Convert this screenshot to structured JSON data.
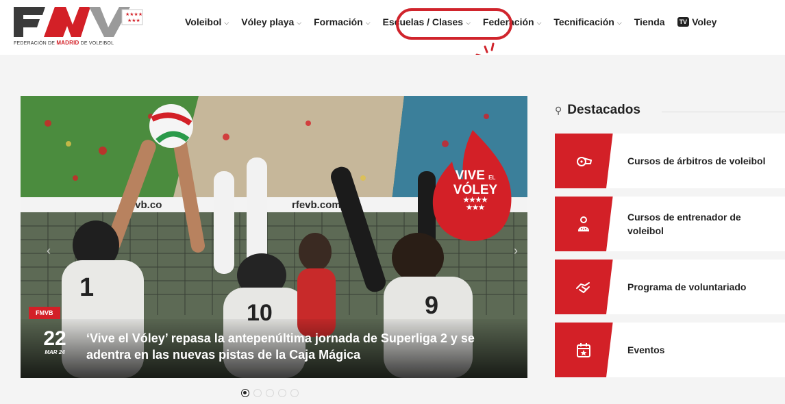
{
  "header": {
    "logo": {
      "mark_text": "FMV",
      "caption_pre": "FEDERACIÓN DE ",
      "caption_red": "MADRID",
      "caption_post": " DE VOLEIBOL"
    },
    "nav": [
      {
        "label": "Voleibol",
        "has_dropdown": true
      },
      {
        "label": "Vóley playa",
        "has_dropdown": true
      },
      {
        "label": "Formación",
        "has_dropdown": true
      },
      {
        "label": "Escuelas / Clases",
        "has_dropdown": true,
        "highlighted": true
      },
      {
        "label": "Federación",
        "has_dropdown": true
      },
      {
        "label": "Tecnificación",
        "has_dropdown": true
      },
      {
        "label": "Tienda",
        "has_dropdown": false
      },
      {
        "label": "Voley",
        "badge": "TV",
        "has_dropdown": false
      }
    ]
  },
  "slider": {
    "tag": "FMVB",
    "day": "22",
    "month": "MAR 24",
    "title": "‘Vive el Vóley’ repasa la antepenúltima jornada de Superliga 2 y se adentra en las nuevas pistas de la Caja Mágica",
    "net_text_1": "rfevb.co",
    "net_text_2": "rfevb.com",
    "badge_line1": "VIVE",
    "badge_small": "EL",
    "badge_line2": "VÓLEY",
    "dots_total": 5,
    "active_dot": 0
  },
  "destacados": {
    "title": "Destacados",
    "items": [
      {
        "label": "Cursos de árbitros de voleibol",
        "icon": "whistle-icon"
      },
      {
        "label": "Cursos de entrenador de voleibol",
        "icon": "coach-icon"
      },
      {
        "label": "Programa de voluntariado",
        "icon": "handshake-icon"
      },
      {
        "label": "Eventos",
        "icon": "calendar-star-icon"
      }
    ]
  },
  "colors": {
    "brand_red": "#d32027",
    "text": "#222222",
    "background": "#f4f4f4"
  }
}
